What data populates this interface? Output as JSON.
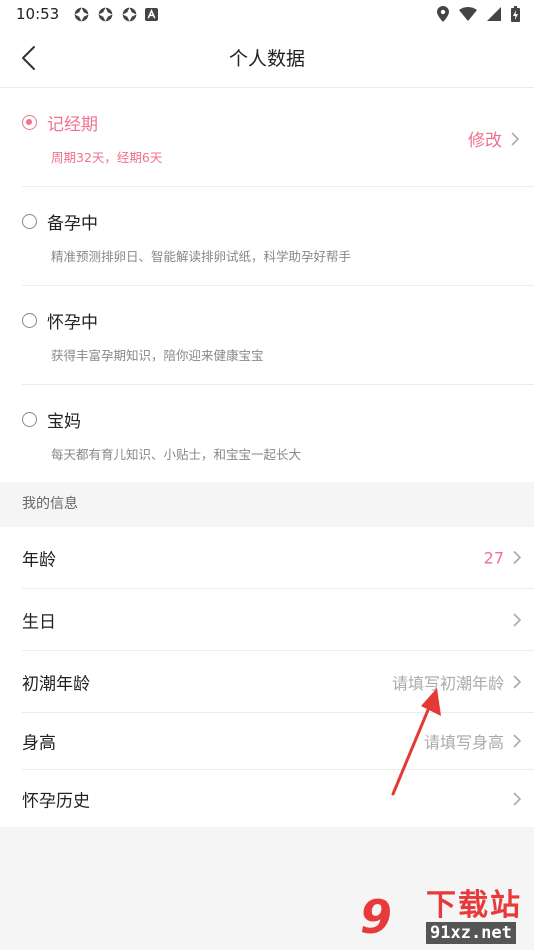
{
  "status_bar": {
    "time": "10:53"
  },
  "app_bar": {
    "title": "个人数据"
  },
  "status_options": [
    {
      "title": "记经期",
      "desc": "周期32天，经期6天",
      "selected": true,
      "action": "修改"
    },
    {
      "title": "备孕中",
      "desc": "精准预测排卵日、智能解读排卵试纸，科学助孕好帮手",
      "selected": false
    },
    {
      "title": "怀孕中",
      "desc": "获得丰富孕期知识，陪你迎来健康宝宝",
      "selected": false
    },
    {
      "title": "宝妈",
      "desc": "每天都有育儿知识、小贴士，和宝宝一起长大",
      "selected": false
    }
  ],
  "my_info": {
    "header": "我的信息",
    "rows": [
      {
        "label": "年龄",
        "value": "27"
      },
      {
        "label": "生日",
        "value": ""
      },
      {
        "label": "初潮年龄",
        "value": "请填写初潮年龄"
      },
      {
        "label": "身高",
        "value": "请填写身高"
      },
      {
        "label": "怀孕历史",
        "value": ""
      }
    ]
  },
  "watermark": {
    "number": "9",
    "text": "下载站",
    "url": "91xz.net"
  },
  "colors": {
    "accent": "#f0728c",
    "divider": "#ececec",
    "background": "#f5f5f5"
  }
}
